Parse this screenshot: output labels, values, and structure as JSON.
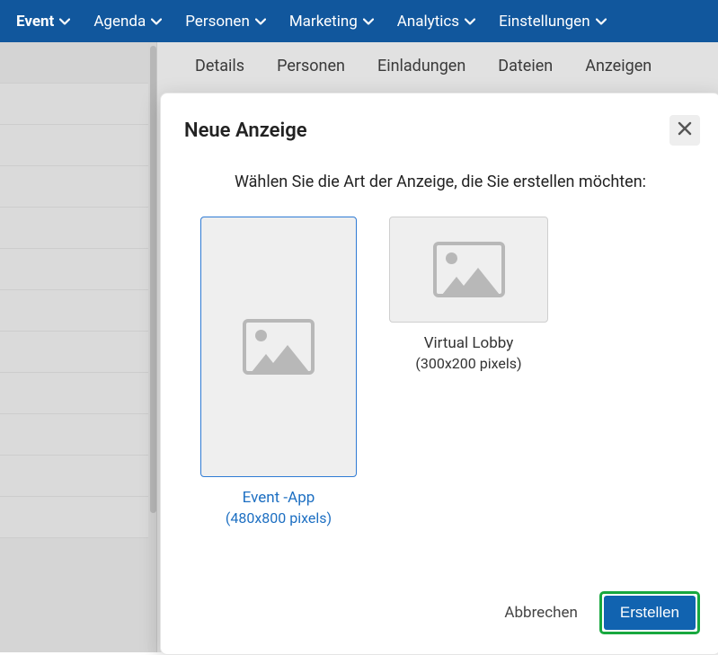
{
  "topnav": {
    "items": [
      {
        "label": "Event"
      },
      {
        "label": "Agenda"
      },
      {
        "label": "Personen"
      },
      {
        "label": "Marketing"
      },
      {
        "label": "Analytics"
      },
      {
        "label": "Einstellungen"
      }
    ]
  },
  "tabs": {
    "items": [
      {
        "label": "Details"
      },
      {
        "label": "Personen"
      },
      {
        "label": "Einladungen"
      },
      {
        "label": "Dateien"
      },
      {
        "label": "Anzeigen"
      }
    ]
  },
  "modal": {
    "title": "Neue Anzeige",
    "instruction": "Wählen Sie die Art der Anzeige, die Sie erstellen möchten:",
    "options": {
      "app": {
        "title": "Event -App",
        "size": "(480x800 pixels)"
      },
      "lobby": {
        "title": "Virtual Lobby",
        "size": "(300x200 pixels)"
      }
    },
    "cancel": "Abbrechen",
    "create": "Erstellen"
  }
}
